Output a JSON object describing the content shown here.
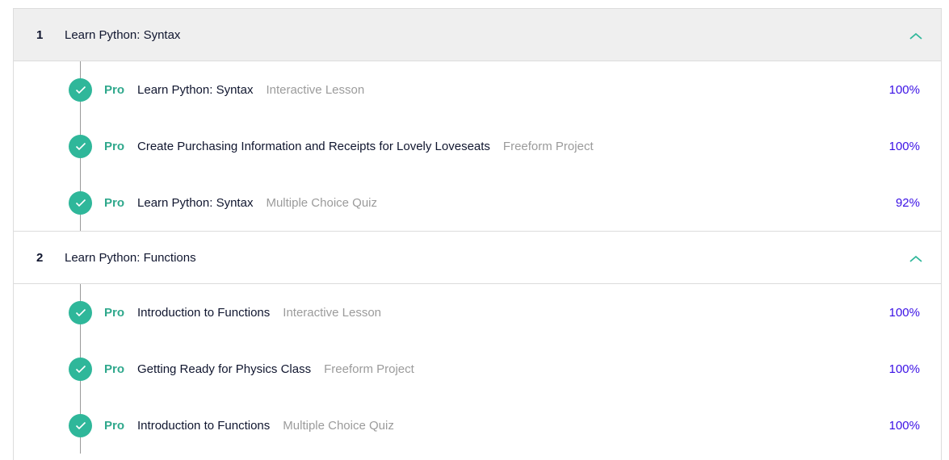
{
  "colors": {
    "accent_green": "#2fb79a",
    "pro_green": "#2fa88c",
    "percent_purple": "#3a10e5",
    "header_bg_active": "#efefef",
    "muted_text": "#9b9b9b"
  },
  "modules": [
    {
      "number": "1",
      "title": "Learn Python: Syntax",
      "chevron_icon": "chevron-up-icon",
      "items": [
        {
          "badge": "Pro",
          "title": "Learn Python: Syntax",
          "type": "Interactive Lesson",
          "percent": "100%",
          "status_icon": "check-icon"
        },
        {
          "badge": "Pro",
          "title": "Create Purchasing Information and Receipts for Lovely Loveseats",
          "type": "Freeform Project",
          "percent": "100%",
          "status_icon": "check-icon"
        },
        {
          "badge": "Pro",
          "title": "Learn Python: Syntax",
          "type": "Multiple Choice Quiz",
          "percent": "92%",
          "status_icon": "check-icon"
        }
      ]
    },
    {
      "number": "2",
      "title": "Learn Python: Functions",
      "chevron_icon": "chevron-up-icon",
      "items": [
        {
          "badge": "Pro",
          "title": "Introduction to Functions",
          "type": "Interactive Lesson",
          "percent": "100%",
          "status_icon": "check-icon"
        },
        {
          "badge": "Pro",
          "title": "Getting Ready for Physics Class",
          "type": "Freeform Project",
          "percent": "100%",
          "status_icon": "check-icon"
        },
        {
          "badge": "Pro",
          "title": "Introduction to Functions",
          "type": "Multiple Choice Quiz",
          "percent": "100%",
          "status_icon": "check-icon"
        }
      ]
    }
  ]
}
